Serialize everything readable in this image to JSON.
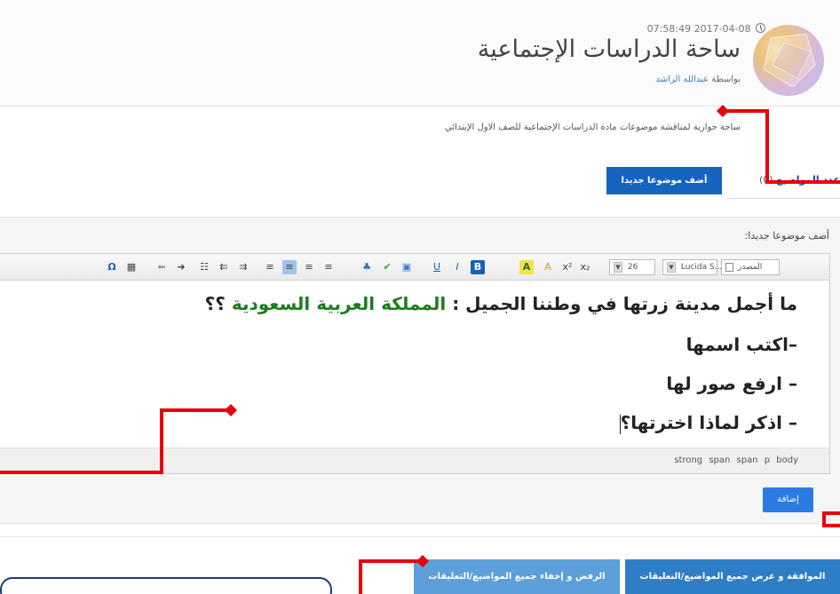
{
  "header": {
    "timestamp": "07:58:49 2017-04-08",
    "title": "ساحة الدراسات الإجتماعية",
    "byline_prefix": "بواسطة",
    "author": "عبدالله الراشد",
    "description": "ساحة حوارية لمناقشة موضوعات مادة الدراسات الإجتماعية للصف الاول الإبتدائي"
  },
  "topics": {
    "count_label": "عدد المواضيع",
    "count_value": "(0)",
    "add_button": "أضف موضوعا جديدا"
  },
  "new_topic": {
    "label": "أضف موضوعا جديدا:",
    "submit_button": "إضافة"
  },
  "editor": {
    "toolbar": {
      "source_label": "المصدر",
      "font_family": "Lucida S...",
      "font_size": "26"
    },
    "content": {
      "line1_prefix": "ما أجمل مدينة زرتها في وطننا الجميل :",
      "line1_highlight": "المملكة العربية السعودية",
      "line1_suffix": "؟؟",
      "line2": "–اكتب اسمها",
      "line3": "– ارفع صور لها",
      "line4": "– اذكر لماذا اخترتها؟"
    },
    "path": "strong span span p body"
  },
  "actions": {
    "approve_all": "الموافقة و عرض جميع المواضيع/التعليقات",
    "reject_all": "الرفض و إخفاء جميع المواضيع/التعليقات"
  },
  "colors": {
    "primary_button": "#1565c0",
    "annotation_red": "#e8000b",
    "highlight_green": "#1e7c1e",
    "callout_border": "#1a3b7a"
  }
}
